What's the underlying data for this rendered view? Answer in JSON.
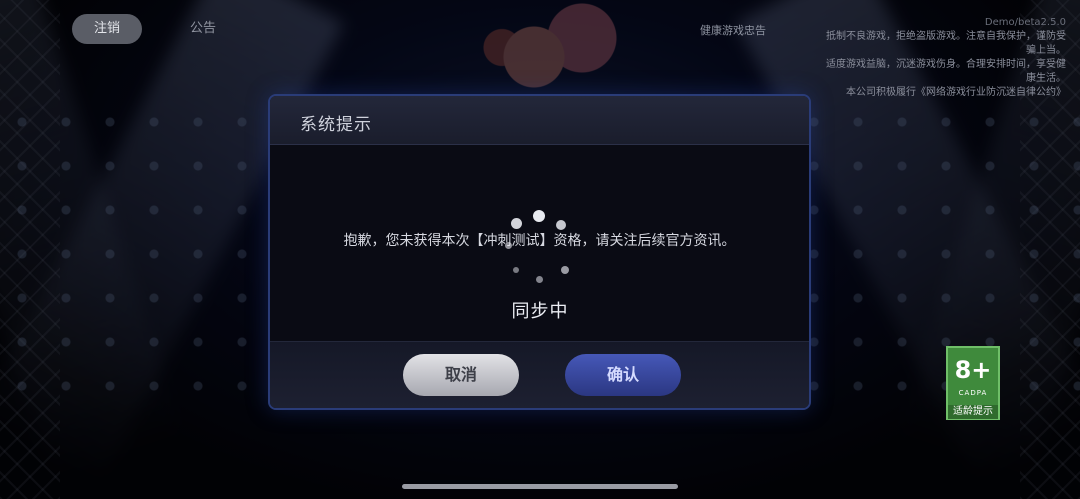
{
  "top_bar": {
    "logout_label": "注销",
    "announcement_label": "公告",
    "health_notice": "健康游戏忠告",
    "version": "Demo/beta2.5.0",
    "notice_lines": [
      "抵制不良游戏，拒绝盗版游戏。注意自我保护，谨防受骗上当。",
      "适度游戏益脑，沉迷游戏伤身。合理安排时间，享受健康生活。",
      "本公司积极履行《网络游戏行业防沉迷自律公约》"
    ]
  },
  "dialog": {
    "title": "系统提示",
    "message": "抱歉，您未获得本次【冲刺测试】资格，请关注后续官方资讯。",
    "cancel_label": "取消",
    "confirm_label": "确认"
  },
  "loading": {
    "status_text": "同步中"
  },
  "age_rating": {
    "rating": "8+",
    "brand": "CADPA",
    "tip_label": "适龄提示"
  },
  "colors": {
    "dialog_border": "#2a3c78",
    "confirm_button": "#3a4aa8",
    "age_badge": "#3f8a3c"
  }
}
